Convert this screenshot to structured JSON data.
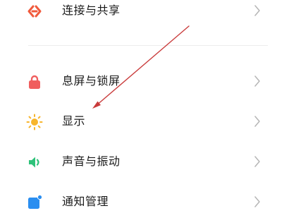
{
  "settings": {
    "items": [
      {
        "label": "连接与共享",
        "icon": "connection-share-icon"
      },
      {
        "label": "息屏与锁屏",
        "icon": "lock-icon"
      },
      {
        "label": "显示",
        "icon": "sun-icon"
      },
      {
        "label": "声音与振动",
        "icon": "speaker-icon"
      },
      {
        "label": "通知管理",
        "icon": "notification-icon"
      }
    ]
  },
  "colors": {
    "connection_icon": "#f05a3c",
    "lock_icon": "#f05e5e",
    "sun_icon": "#f7b52c",
    "speaker_icon": "#2fc27a",
    "notification_icon": "#2a8ef0",
    "annotation_arrow": "#c93b3b"
  }
}
